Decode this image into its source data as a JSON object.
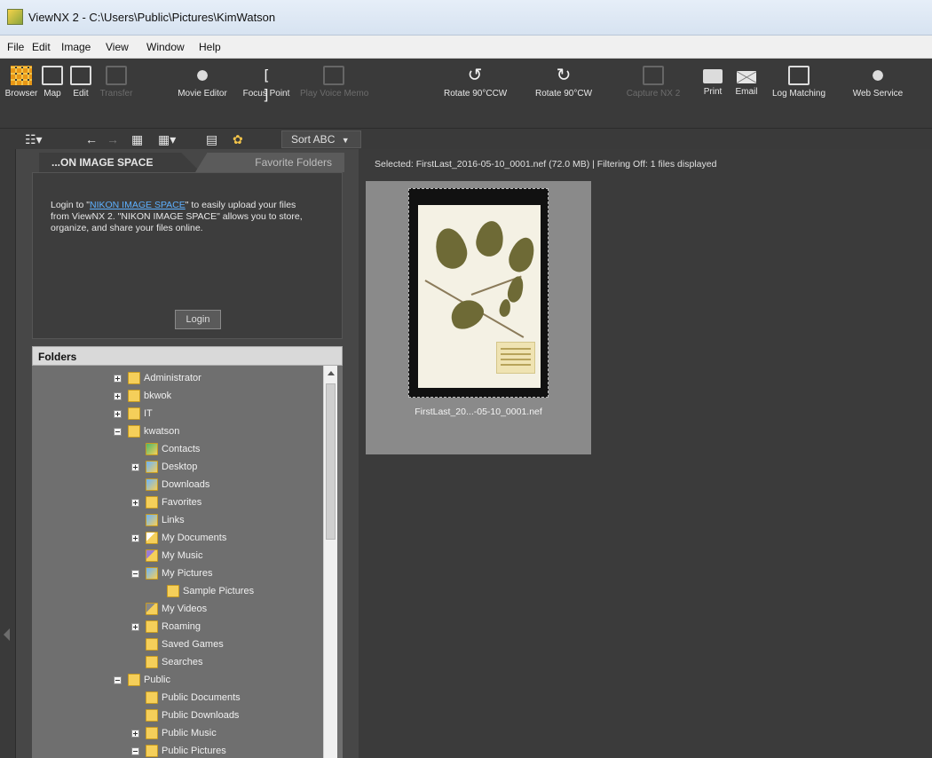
{
  "window": {
    "title": "ViewNX 2 - C:\\Users\\Public\\Pictures\\KimWatson"
  },
  "menu": [
    "File",
    "Edit",
    "Image",
    "View",
    "Window",
    "Help"
  ],
  "toolbar": [
    {
      "label": "Browser",
      "icon": "grid-icon",
      "enabled": true
    },
    {
      "label": "Map",
      "icon": "map-icon",
      "enabled": true
    },
    {
      "label": "Edit",
      "icon": "edit-icon",
      "enabled": true
    },
    {
      "label": "Transfer",
      "icon": "transfer-icon",
      "enabled": false
    },
    {
      "label": "Movie Editor",
      "icon": "movie-editor-icon",
      "enabled": true
    },
    {
      "label": "Focus Point",
      "icon": "focus-point-icon",
      "enabled": true
    },
    {
      "label": "Play Voice Memo",
      "icon": "voice-memo-icon",
      "enabled": false
    },
    {
      "label": "Rotate 90°CCW",
      "icon": "rotate-ccw-icon",
      "enabled": true
    },
    {
      "label": "Rotate 90°CW",
      "icon": "rotate-cw-icon",
      "enabled": true
    },
    {
      "label": "Capture NX 2",
      "icon": "capture-nx-icon",
      "enabled": false
    },
    {
      "label": "Print",
      "icon": "printer-icon",
      "enabled": true
    },
    {
      "label": "Email",
      "icon": "envelope-icon",
      "enabled": true
    },
    {
      "label": "Log Matching",
      "icon": "log-matching-icon",
      "enabled": true
    },
    {
      "label": "Web Service",
      "icon": "web-service-icon",
      "enabled": true
    }
  ],
  "toolbar2": {
    "sort_label": "Sort ABC"
  },
  "left_panel": {
    "tabs": {
      "active": "...ON IMAGE SPACE",
      "inactive": "Favorite Folders"
    },
    "nis": {
      "text_prefix": "Login to \"",
      "link": "NIKON IMAGE SPACE",
      "text_suffix": "\" to easily upload your files from ViewNX 2. \"NIKON IMAGE SPACE\" allows you to store, organize, and share your files online.",
      "login_label": "Login"
    },
    "folders_header": "Folders",
    "tree": [
      {
        "name": "Administrator",
        "level": 0,
        "expander": "plus",
        "icon": "folder"
      },
      {
        "name": "bkwok",
        "level": 0,
        "expander": "plus",
        "icon": "folder"
      },
      {
        "name": "IT",
        "level": 0,
        "expander": "plus",
        "icon": "folder"
      },
      {
        "name": "kwatson",
        "level": 0,
        "expander": "minus",
        "icon": "folder"
      },
      {
        "name": "Contacts",
        "level": 1,
        "expander": "",
        "icon": "green"
      },
      {
        "name": "Desktop",
        "level": 1,
        "expander": "plus",
        "icon": "blue"
      },
      {
        "name": "Downloads",
        "level": 1,
        "expander": "",
        "icon": "blue"
      },
      {
        "name": "Favorites",
        "level": 1,
        "expander": "plus",
        "icon": "folder"
      },
      {
        "name": "Links",
        "level": 1,
        "expander": "",
        "icon": "blue"
      },
      {
        "name": "My Documents",
        "level": 1,
        "expander": "plus",
        "icon": "doc"
      },
      {
        "name": "My Music",
        "level": 1,
        "expander": "",
        "icon": "music"
      },
      {
        "name": "My Pictures",
        "level": 1,
        "expander": "minus",
        "icon": "blue"
      },
      {
        "name": "Sample Pictures",
        "level": 2,
        "expander": "",
        "icon": "folder"
      },
      {
        "name": "My Videos",
        "level": 1,
        "expander": "",
        "icon": "vid"
      },
      {
        "name": "Roaming",
        "level": 1,
        "expander": "plus",
        "icon": "folder"
      },
      {
        "name": "Saved Games",
        "level": 1,
        "expander": "",
        "icon": "folder"
      },
      {
        "name": "Searches",
        "level": 1,
        "expander": "",
        "icon": "folder"
      },
      {
        "name": "Public",
        "level": 0,
        "expander": "minus",
        "icon": "folder"
      },
      {
        "name": "Public Documents",
        "level": 1,
        "expander": "",
        "icon": "folder"
      },
      {
        "name": "Public Downloads",
        "level": 1,
        "expander": "",
        "icon": "folder"
      },
      {
        "name": "Public Music",
        "level": 1,
        "expander": "plus",
        "icon": "folder"
      },
      {
        "name": "Public Pictures",
        "level": 1,
        "expander": "minus",
        "icon": "folder"
      }
    ]
  },
  "content": {
    "status": "Selected: FirstLast_2016-05-10_0001.nef (72.0 MB) | Filtering Off: 1 files displayed",
    "thumbnail_caption": "FirstLast_20...-05-10_0001.nef"
  }
}
